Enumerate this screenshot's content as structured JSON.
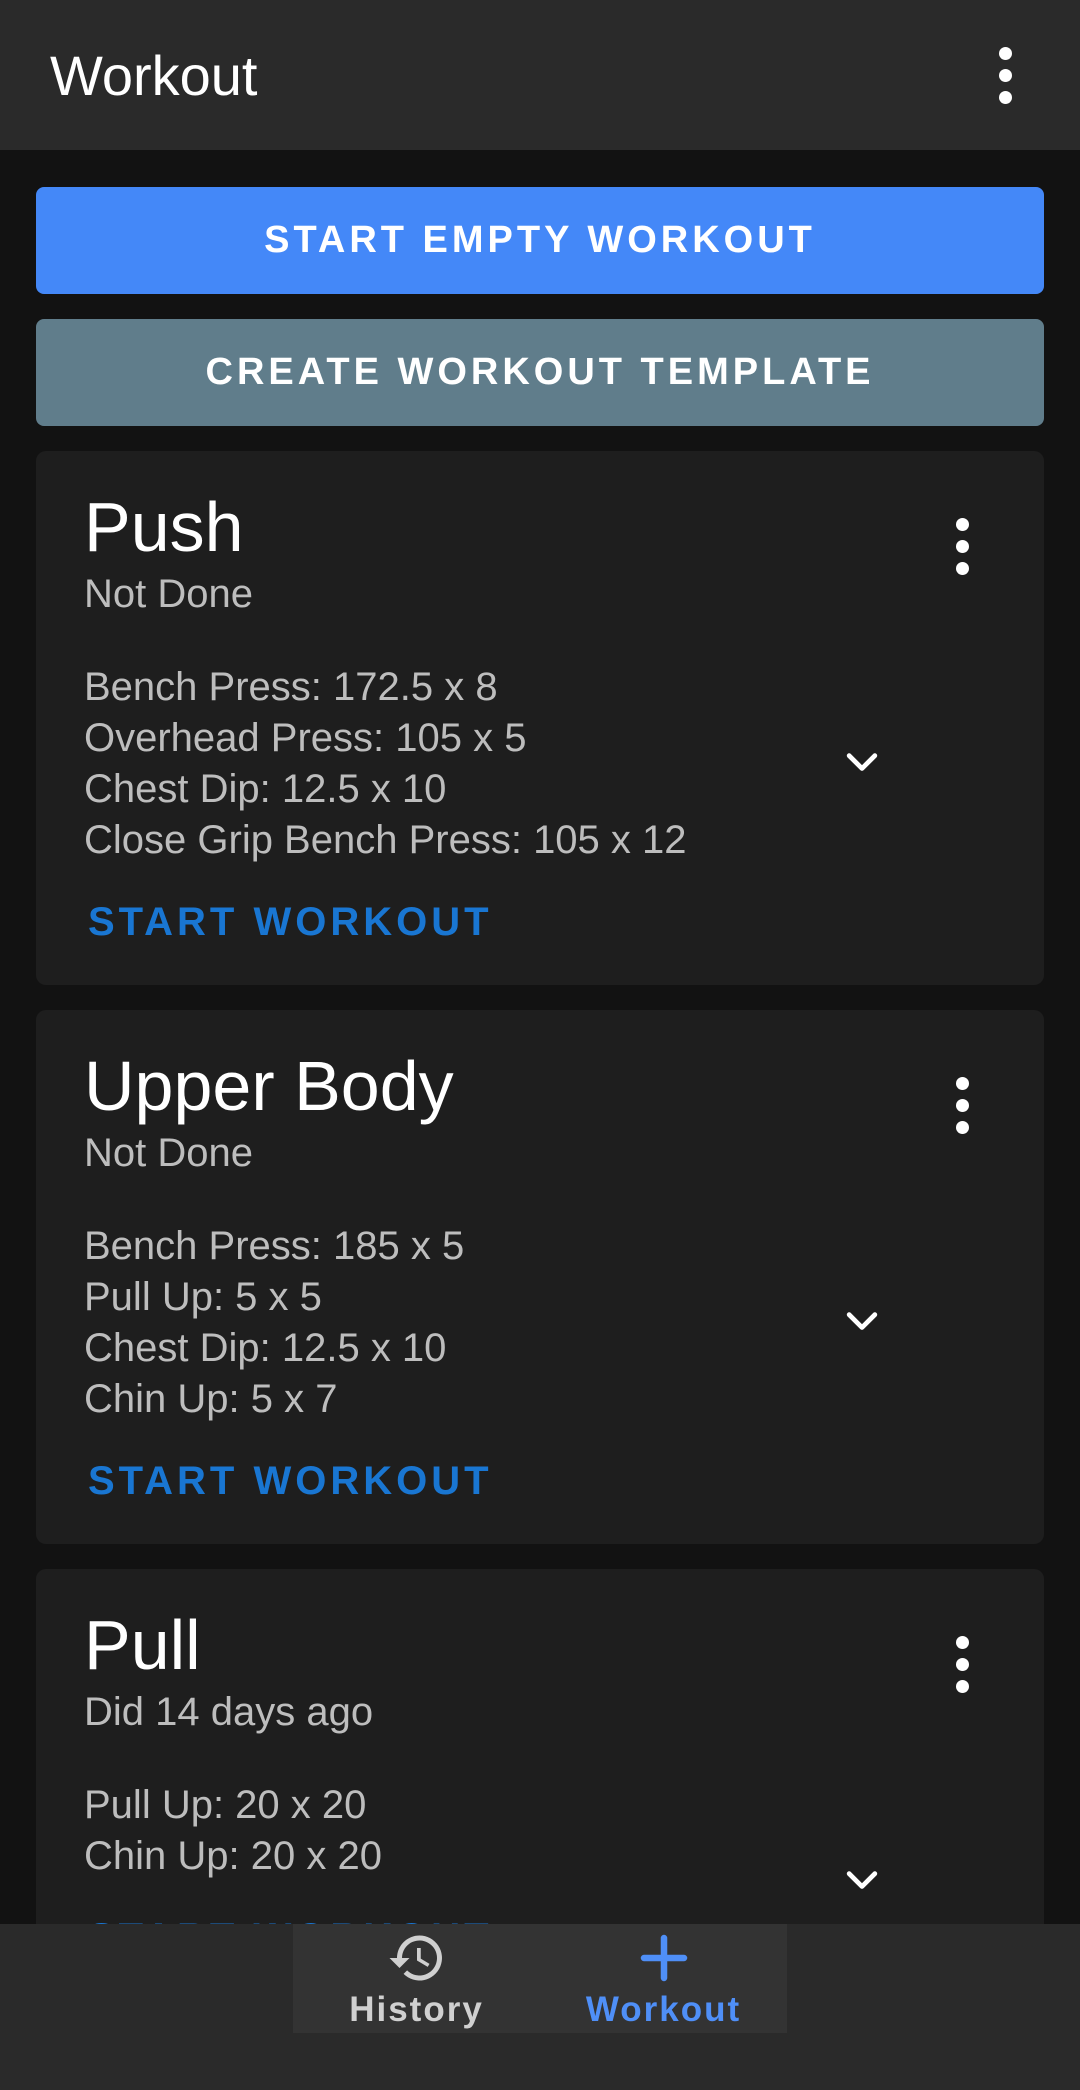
{
  "appbar": {
    "title": "Workout",
    "menu_icon": "more-vert-icon"
  },
  "actions": {
    "start_empty": "START EMPTY WORKOUT",
    "create_template": "CREATE WORKOUT TEMPLATE"
  },
  "templates": [
    {
      "title": "Push",
      "status": "Not Done",
      "exercises": [
        "Bench Press: 172.5 x 8",
        "Overhead Press: 105 x 5",
        "Chest Dip: 12.5 x 10",
        "Close Grip Bench Press: 105 x 12"
      ],
      "start_label": "START WORKOUT"
    },
    {
      "title": "Upper Body",
      "status": "Not Done",
      "exercises": [
        "Bench Press: 185 x 5",
        "Pull Up: 5 x 5",
        "Chest Dip: 12.5 x 10",
        "Chin Up: 5 x 7"
      ],
      "start_label": "START WORKOUT"
    },
    {
      "title": "Pull",
      "status": "Did 14 days ago",
      "exercises": [
        "Pull Up: 20 x 20",
        "Chin Up: 20 x 20"
      ],
      "start_label": "START WORKOUT"
    }
  ],
  "bottom_nav": {
    "items": [
      {
        "label": "History",
        "icon": "history-icon",
        "active": false
      },
      {
        "label": "Workout",
        "icon": "plus-icon",
        "active": true
      }
    ]
  },
  "colors": {
    "primary": "#4488f8",
    "secondary": "#607d8b",
    "accent_text": "#1976d2",
    "card_bg": "#1e1e1e",
    "background": "#121212"
  }
}
